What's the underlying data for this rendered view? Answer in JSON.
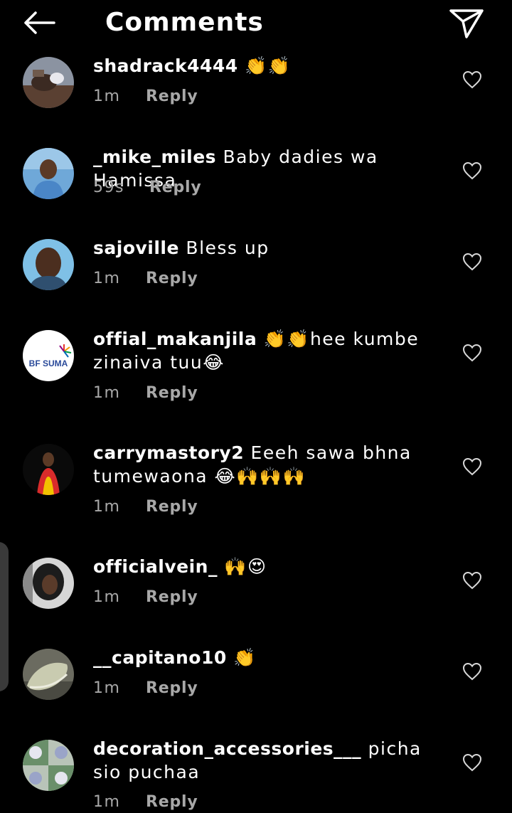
{
  "header": {
    "title": "Comments",
    "back_icon": "arrow-left-icon",
    "share_icon": "paper-plane-icon"
  },
  "comments": [
    {
      "username": "shadrack4444",
      "text": "👏👏",
      "time": "1m",
      "reply": "Reply"
    },
    {
      "username": "_mike_miles",
      "text": "Baby dadies wa Hamissa",
      "time": "59s",
      "reply": "Reply"
    },
    {
      "username": "sajoville",
      "text": "Bless up",
      "time": "1m",
      "reply": "Reply"
    },
    {
      "username": "offial_makanjila",
      "text": "👏👏hee kumbe zinaiva tuu😂",
      "time": "1m",
      "reply": "Reply",
      "avatar_text": "BF SUMA"
    },
    {
      "username": "carrymastory2",
      "text": "Eeeh sawa bhna tumewaona 😂🙌🙌🙌",
      "time": "1m",
      "reply": "Reply"
    },
    {
      "username": "officialvein_",
      "text": "🙌😍",
      "time": "1m",
      "reply": "Reply"
    },
    {
      "username": "__capitano10",
      "text": "👏",
      "time": "1m",
      "reply": "Reply"
    },
    {
      "username": "decoration_accessories___",
      "text": "picha sio puchaa",
      "time": "1m",
      "reply": "Reply"
    }
  ]
}
